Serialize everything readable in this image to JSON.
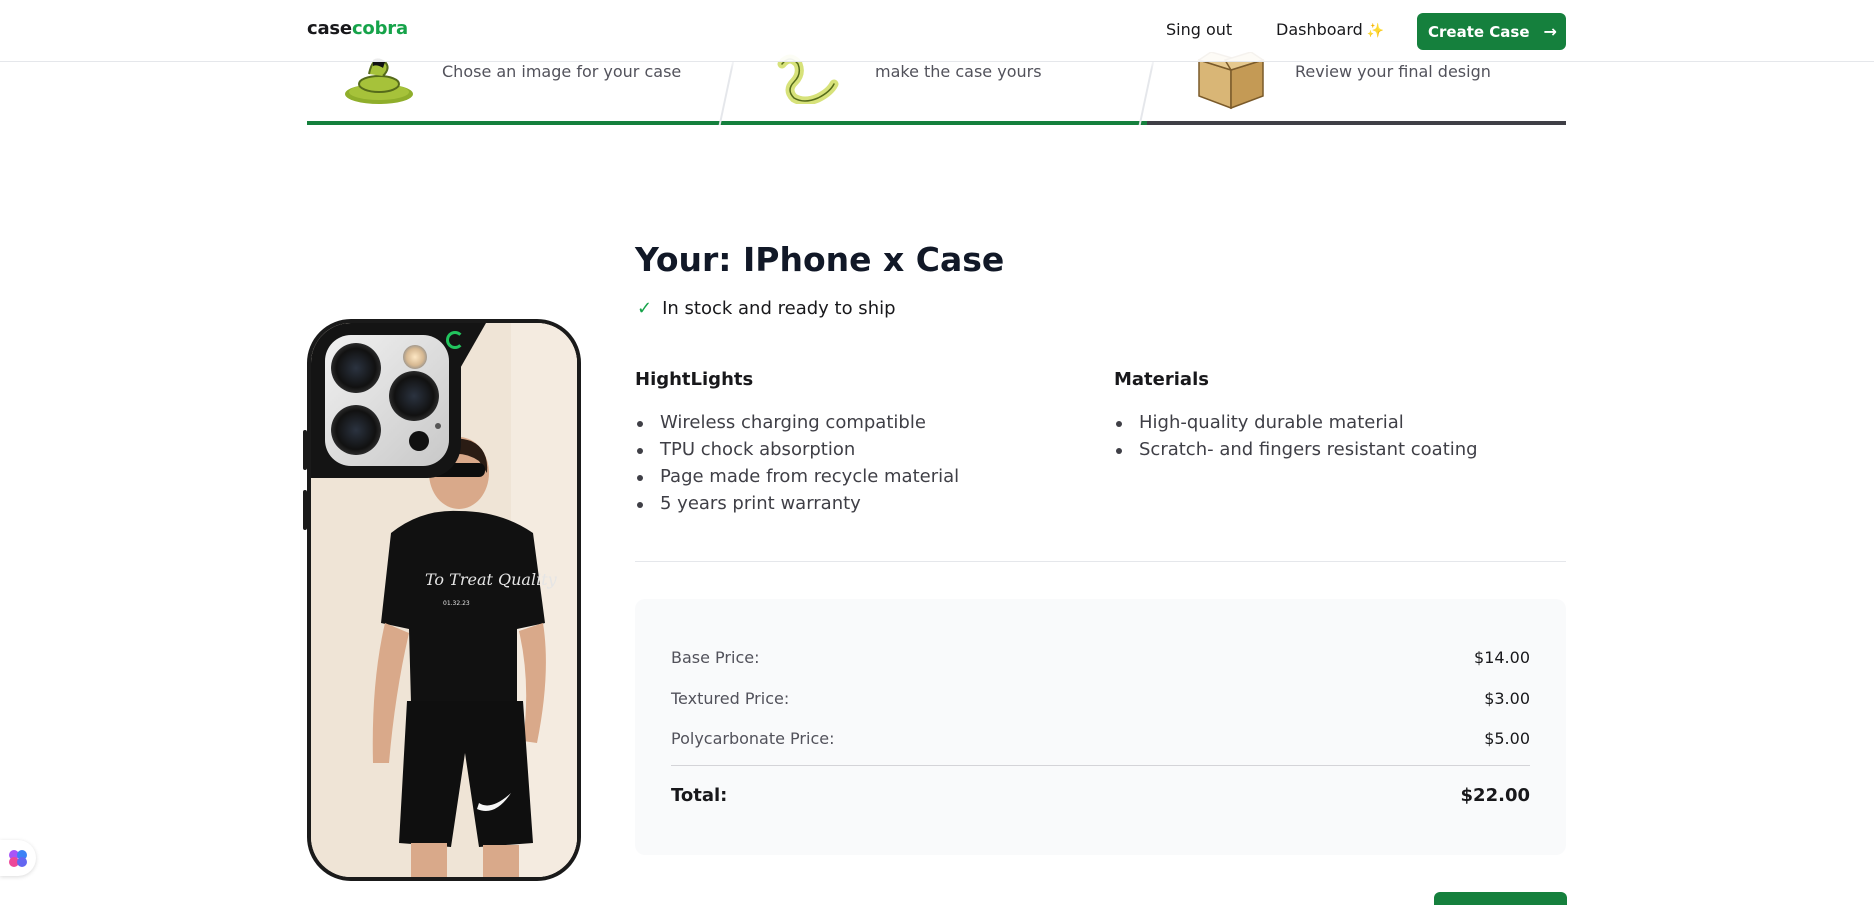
{
  "navbar": {
    "logo_part1": "case",
    "logo_part2": "cobra",
    "signout_label": "Sing out",
    "dashboard_label": "Dashboard",
    "dashboard_emoji": "✨",
    "create_label": "Create Case",
    "create_arrow": "→"
  },
  "steps": [
    {
      "description": "Chose an image for your case",
      "state": "complete",
      "bar_color": "#15803d"
    },
    {
      "description": "make the case yours",
      "state": "complete",
      "bar_color": "#15803d"
    },
    {
      "description": "Review your final design",
      "state": "current",
      "bar_color": "#3f3f46"
    }
  ],
  "product": {
    "title": "Your: IPhone x Case",
    "stock_icon": "check-icon",
    "stock_text": "In stock and ready to ship"
  },
  "highlights": {
    "heading": "HightLights",
    "items": [
      "Wireless charging compatible",
      "TPU chock absorption",
      "Page made from recycle material",
      "5 years print warranty"
    ]
  },
  "materials": {
    "heading": "Materials",
    "items": [
      "High-quality durable material",
      "Scratch- and fingers resistant coating"
    ]
  },
  "pricing": {
    "rows": [
      {
        "label": "Base Price:",
        "value": "$14.00"
      },
      {
        "label": "Textured Price:",
        "value": "$3.00"
      },
      {
        "label": "Polycarbonate Price:",
        "value": "$5.00"
      }
    ],
    "total_label": "Total:",
    "total_value": "$22.00"
  },
  "colors": {
    "brand": "#16a34a",
    "button": "#15803d"
  }
}
